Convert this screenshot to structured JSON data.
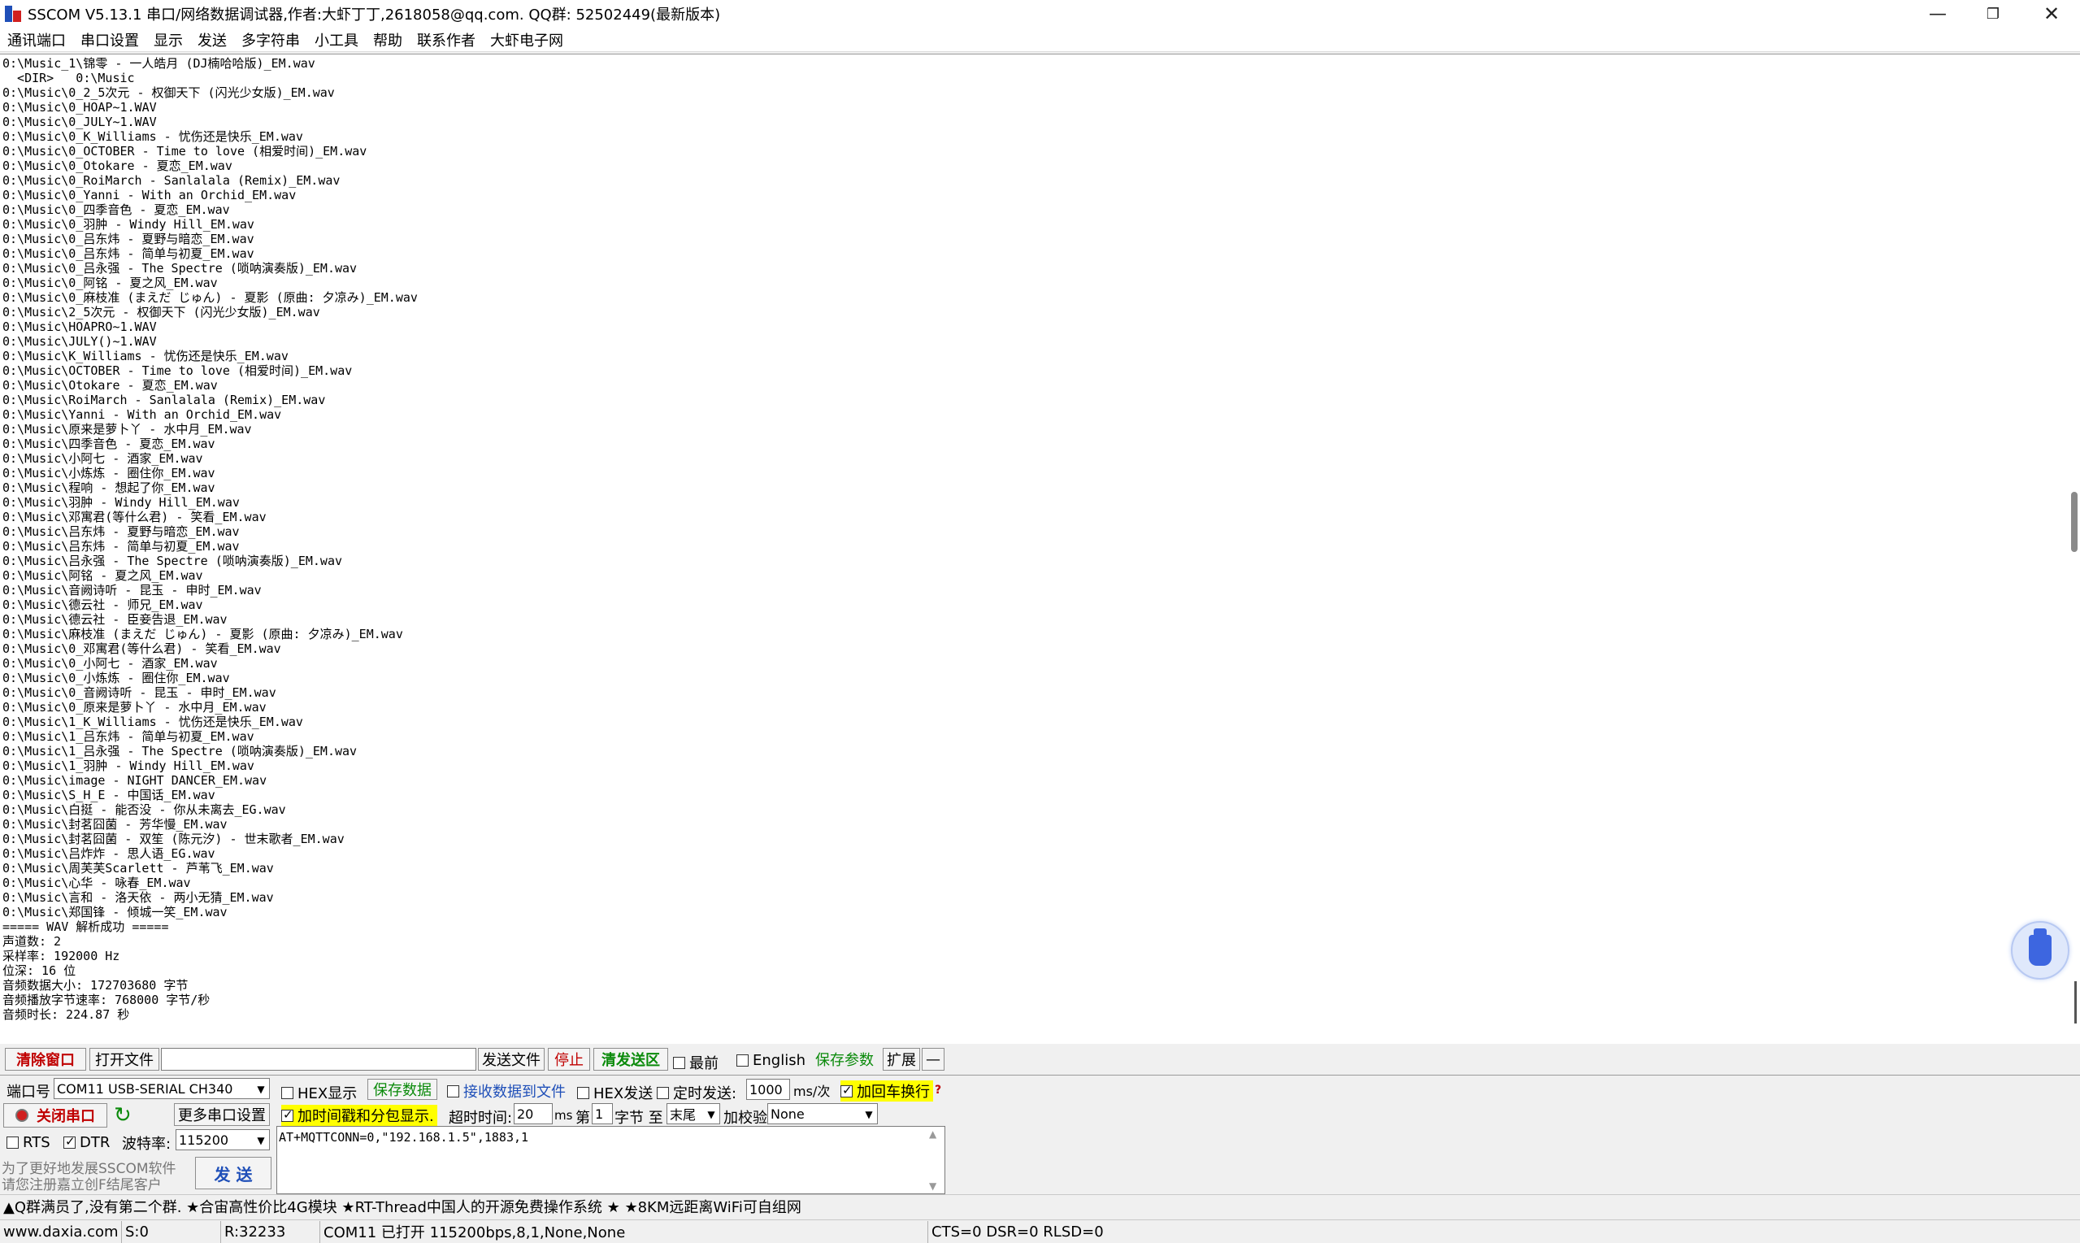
{
  "window": {
    "title": "SSCOM V5.13.1 串口/网络数据调试器,作者:大虾丁丁,2618058@qq.com. QQ群: 52502449(最新版本)",
    "min_icon": "minimize-icon",
    "max_icon": "maximize-icon",
    "close_icon": "close-icon"
  },
  "menu": [
    "通讯端口",
    "串口设置",
    "显示",
    "发送",
    "多字符串",
    "小工具",
    "帮助",
    "联系作者",
    "大虾电子网"
  ],
  "receive": {
    "lines": [
      "0:\\Music_1\\锦零 - 一人皓月 (DJ楠哈哈版)_EM.wav",
      "  <DIR>   0:\\Music",
      "0:\\Music\\0_2_5次元 - 权御天下 (闪光少女版)_EM.wav",
      "0:\\Music\\0_HOAP~1.WAV",
      "0:\\Music\\0_JULY~1.WAV",
      "0:\\Music\\0_K_Williams - 忧伤还是快乐_EM.wav",
      "0:\\Music\\0_OCTOBER - Time to love (相爱时间)_EM.wav",
      "0:\\Music\\0_Otokare - 夏恋_EM.wav",
      "0:\\Music\\0_RoiMarch - Sanlalala (Remix)_EM.wav",
      "0:\\Music\\0_Yanni - With an Orchid_EM.wav",
      "0:\\Music\\0_四季音色 - 夏恋_EM.wav",
      "0:\\Music\\0_羽肿 - Windy Hill_EM.wav",
      "0:\\Music\\0_吕东炜 - 夏野与暗恋_EM.wav",
      "0:\\Music\\0_吕东炜 - 简单与初夏_EM.wav",
      "0:\\Music\\0_吕永强 - The Spectre (唢呐演奏版)_EM.wav",
      "0:\\Music\\0_阿铭 - 夏之风_EM.wav",
      "0:\\Music\\0_麻枝准 (まえだ じゅん) - 夏影 (原曲: 夕凉み)_EM.wav",
      "0:\\Music\\2_5次元 - 权御天下 (闪光少女版)_EM.wav",
      "0:\\Music\\HOAPRO~1.WAV",
      "0:\\Music\\JULY()~1.WAV",
      "0:\\Music\\K_Williams - 忧伤还是快乐_EM.wav",
      "0:\\Music\\OCTOBER - Time to love (相爱时间)_EM.wav",
      "0:\\Music\\Otokare - 夏恋_EM.wav",
      "0:\\Music\\RoiMarch - Sanlalala (Remix)_EM.wav",
      "0:\\Music\\Yanni - With an Orchid_EM.wav",
      "0:\\Music\\原来是萝卜丫 - 水中月_EM.wav",
      "0:\\Music\\四季音色 - 夏恋_EM.wav",
      "0:\\Music\\小阿七 - 酒家_EM.wav",
      "0:\\Music\\小炼炼 - 圈住你_EM.wav",
      "0:\\Music\\程响 - 想起了你_EM.wav",
      "0:\\Music\\羽肿 - Windy Hill_EM.wav",
      "0:\\Music\\邓寓君(等什么君) - 笑看_EM.wav",
      "0:\\Music\\吕东炜 - 夏野与暗恋_EM.wav",
      "0:\\Music\\吕东炜 - 简单与初夏_EM.wav",
      "0:\\Music\\吕永强 - The Spectre (唢呐演奏版)_EM.wav",
      "0:\\Music\\阿铭 - 夏之风_EM.wav",
      "0:\\Music\\音阙诗听 - 昆玉 - 申时_EM.wav",
      "0:\\Music\\德云社 - 师兄_EM.wav",
      "0:\\Music\\德云社 - 臣妾告退_EM.wav",
      "0:\\Music\\麻枝准 (まえだ じゅん) - 夏影 (原曲: 夕凉み)_EM.wav",
      "0:\\Music\\0_邓寓君(等什么君) - 笑看_EM.wav",
      "0:\\Music\\0_小阿七 - 酒家_EM.wav",
      "0:\\Music\\0_小炼炼 - 圈住你_EM.wav",
      "0:\\Music\\0_音阙诗听 - 昆玉 - 申时_EM.wav",
      "0:\\Music\\0_原来是萝卜丫 - 水中月_EM.wav",
      "0:\\Music\\1_K_Williams - 忧伤还是快乐_EM.wav",
      "0:\\Music\\1_吕东炜 - 简单与初夏_EM.wav",
      "0:\\Music\\1_吕永强 - The Spectre (唢呐演奏版)_EM.wav",
      "0:\\Music\\1_羽肿 - Windy Hill_EM.wav",
      "0:\\Music\\image - NIGHT DANCER_EM.wav",
      "0:\\Music\\S_H_E - 中国话_EM.wav",
      "0:\\Music\\白挺 - 能否没 - 你从未离去_EG.wav",
      "0:\\Music\\封茗囧菌 - 芳华慢_EM.wav",
      "0:\\Music\\封茗囧菌 - 双笙 (陈元汐) - 世末歌者_EM.wav",
      "0:\\Music\\吕炸炸 - 思人语_EG.wav",
      "0:\\Music\\周芙芙Scarlett - 芦苇飞_EM.wav",
      "0:\\Music\\心华 - 咏春_EM.wav",
      "0:\\Music\\言和 - 洛天依 - 两小无猜_EM.wav",
      "0:\\Music\\郑国锋 - 倾城一笑_EM.wav",
      "===== WAV 解析成功 =====",
      "声道数: 2",
      "采样率: 192000 Hz",
      "位深: 16 位",
      "音频数据大小: 172703680 字节",
      "音频播放字节速率: 768000 字节/秒",
      "音频时长: 224.87 秒"
    ]
  },
  "toolbar": {
    "clear_window": "清除窗口",
    "open_file": "打开文件",
    "file_path": "",
    "send_file": "发送文件",
    "stop": "停止",
    "clear_send": "清发送区",
    "topmost": "最前",
    "english": "English",
    "save_params": "保存参数",
    "expand": "扩展",
    "collapse": "—"
  },
  "port": {
    "port_label": "端口号",
    "port_value": "COM11 USB-SERIAL CH340",
    "close_port": "关闭串口",
    "more_settings": "更多串口设置",
    "rts": "RTS",
    "dtr": "DTR",
    "baud_label": "波特率:",
    "baud_value": "115200",
    "promo_line1": "为了更好地发展SSCOM软件",
    "promo_line2": "请您注册嘉立创F结尾客户",
    "send_button": "发  送"
  },
  "options": {
    "hex_display": "HEX显示",
    "save_data": "保存数据",
    "recv_to_file": "接收数据到文件",
    "hex_send": "HEX发送",
    "timed_send": "定时发送:",
    "interval": "1000",
    "interval_unit": "ms/次",
    "add_crlf": "加回车换行",
    "timestamp": "加时间戳和分包显示.",
    "timeout_label": "超时时间:",
    "timeout_value": "20",
    "timeout_unit": "ms",
    "nth_label": "第",
    "nth_value": "1",
    "byte_to": "字节 至",
    "end_value": "末尾",
    "checksum_label": "加校验",
    "checksum_value": "None",
    "help": "?"
  },
  "send_text": "AT+MQTTCONN=0,\"192.168.1.5\",1883,1",
  "ad_bar": "▲Q群满员了,没有第二个群. ★合宙高性价比4G模块 ★RT-Thread中国人的开源免费操作系统 ★ ★8KM远距离WiFi可自组网",
  "status": {
    "website": "www.daxia.com",
    "sent": "S:0",
    "received": "R:32233",
    "port_state": "COM11 已打开  115200bps,8,1,None,None",
    "lines": "CTS=0 DSR=0 RLSD=0"
  },
  "colors": {
    "red": "#c00000",
    "green": "#0a8a0a",
    "blue": "#1f4fb8",
    "highlight": "#ffff00"
  }
}
